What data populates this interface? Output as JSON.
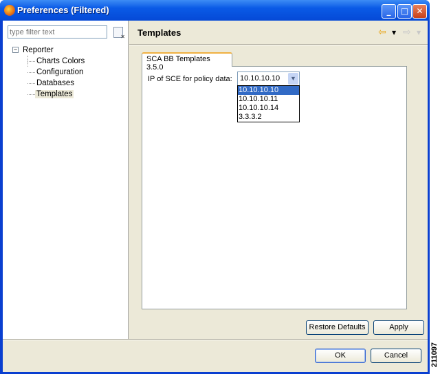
{
  "window": {
    "title": "Preferences (Filtered)"
  },
  "sidebar": {
    "filter_placeholder": "type filter text",
    "tree": {
      "root": "Reporter",
      "children": [
        "Charts Colors",
        "Configuration",
        "Databases",
        "Templates"
      ],
      "selected": "Templates"
    }
  },
  "main": {
    "header": "Templates",
    "tab": "SCA BB Templates 3.5.0",
    "field_label": "IP of SCE for policy data:",
    "combo_value": "10.10.10.10",
    "options": [
      "10.10.10.10",
      "10.10.10.11",
      "10.10.10.14",
      "3.3.3.2"
    ],
    "restore_defaults": "Restore Defaults",
    "apply": "Apply"
  },
  "footer": {
    "ok": "OK",
    "cancel": "Cancel"
  },
  "figure_id": "211097"
}
